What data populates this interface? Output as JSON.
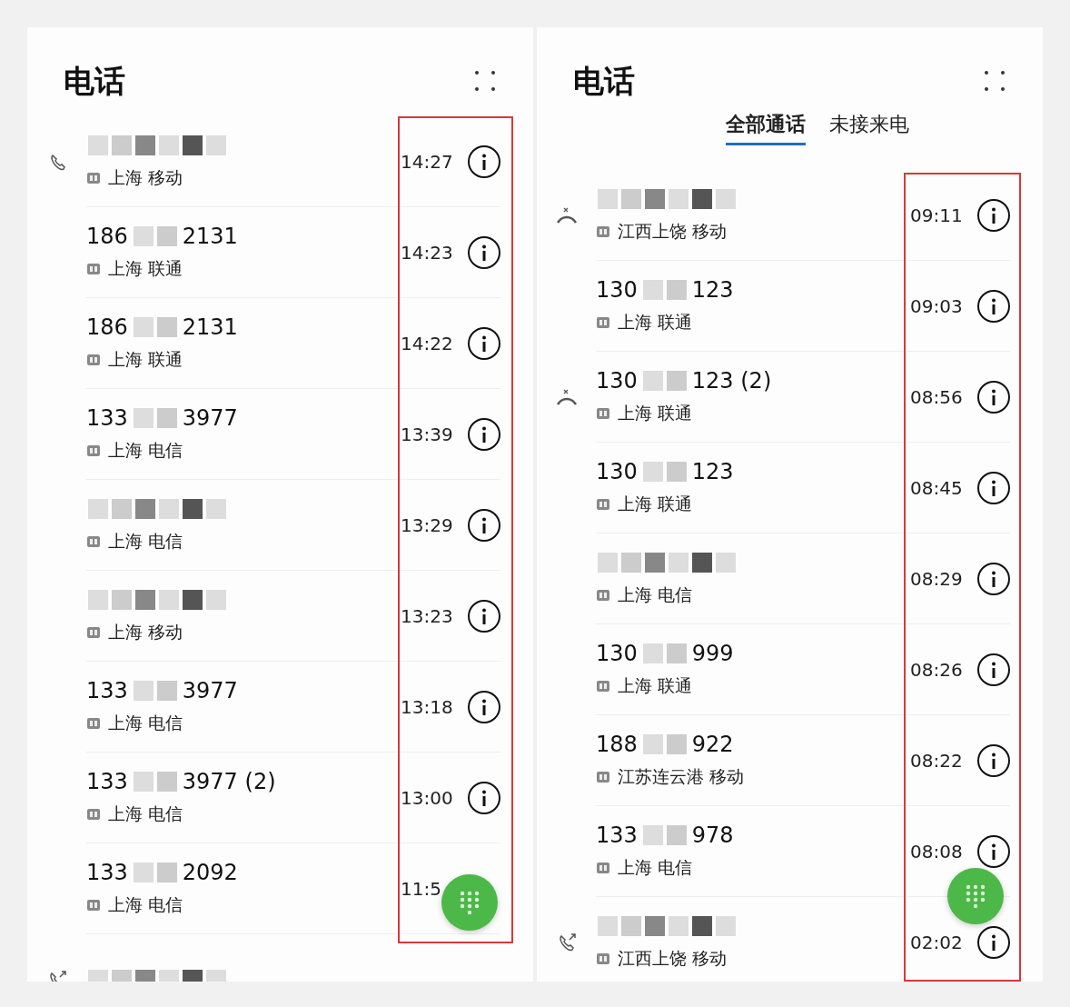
{
  "panels": [
    {
      "title": "电话",
      "calls": [
        {
          "kind": "incoming",
          "location": "上海 移动",
          "time": "14:27",
          "info": true
        },
        {
          "kind": "none",
          "number_start": "186",
          "number_end": "2131",
          "location": "上海 联通",
          "time": "14:23",
          "info": true
        },
        {
          "kind": "none",
          "number_start": "186",
          "number_end": "2131",
          "location": "上海 联通",
          "time": "14:22",
          "info": true
        },
        {
          "kind": "none",
          "number_start": "133",
          "number_end": "3977",
          "location": "上海 电信",
          "time": "13:39",
          "info": true
        },
        {
          "kind": "none",
          "location": "上海 电信",
          "time": "13:29",
          "info": true
        },
        {
          "kind": "none",
          "location": "上海 移动",
          "time": "13:23",
          "info": true
        },
        {
          "kind": "none",
          "number_start": "133",
          "number_end": "3977",
          "location": "上海 电信",
          "time": "13:18",
          "info": true
        },
        {
          "kind": "none",
          "number_start": "133",
          "number_end": "3977 (2)",
          "location": "上海 电信",
          "time": "13:00",
          "info": true
        },
        {
          "kind": "none",
          "number_start": "133",
          "number_end": "2092",
          "location": "上海 电信",
          "time": "11:5",
          "info": false
        },
        {
          "kind": "outgoing",
          "info": false
        }
      ]
    },
    {
      "title": "电话",
      "tabs": [
        {
          "label": "全部通话",
          "selected": true
        },
        {
          "label": "未接来电",
          "selected": false
        }
      ],
      "calls": [
        {
          "kind": "missed",
          "location": "江西上饶 移动",
          "time": "09:11",
          "info": true
        },
        {
          "kind": "none",
          "number_start": "130",
          "number_end": "123",
          "location": "上海 联通",
          "time": "09:03",
          "info": true
        },
        {
          "kind": "missed",
          "number_start": "130",
          "number_end": "123 (2)",
          "location": "上海 联通",
          "time": "08:56",
          "info": true
        },
        {
          "kind": "none",
          "number_start": "130",
          "number_end": "123",
          "location": "上海 联通",
          "time": "08:45",
          "info": true
        },
        {
          "kind": "none",
          "location": "上海 电信",
          "time": "08:29",
          "info": true
        },
        {
          "kind": "none",
          "number_start": "130",
          "number_end": "999",
          "location": "上海 联通",
          "time": "08:26",
          "info": true
        },
        {
          "kind": "none",
          "number_start": "188",
          "number_end": "922",
          "location": "江苏连云港 移动",
          "time": "08:22",
          "info": true
        },
        {
          "kind": "none",
          "number_start": "133",
          "number_end": "978",
          "location": "上海 电信",
          "time": "08:08",
          "info": true
        },
        {
          "kind": "outgoing",
          "location": "江西上饶 移动",
          "time": "02:02",
          "info": true
        }
      ]
    }
  ]
}
